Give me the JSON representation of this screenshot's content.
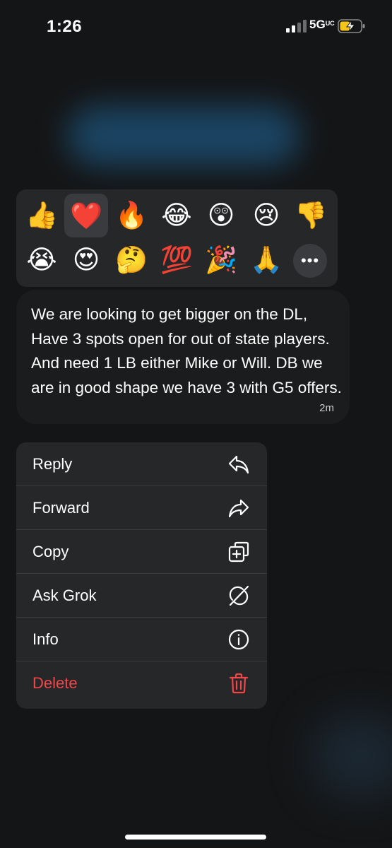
{
  "status_bar": {
    "time": "1:26",
    "network": "5G",
    "network_suffix": "UC"
  },
  "reactions": {
    "row1": [
      "👍",
      "❤️",
      "🔥",
      "😂",
      "😲",
      "😢",
      "👎"
    ],
    "row2": [
      "😭",
      "😍",
      "🤔",
      "💯",
      "🎉",
      "🙏"
    ],
    "more_label": "•••",
    "selected_index": 1
  },
  "message": {
    "text": "We are looking to get bigger on the DL, Have 3 spots open for out of state players. And need 1 LB either Mike or Will. DB we are in good shape we have 3 with G5 offers.",
    "time": "2m"
  },
  "menu": {
    "reply": "Reply",
    "forward": "Forward",
    "copy": "Copy",
    "ask_grok": "Ask Grok",
    "info": "Info",
    "delete": "Delete"
  },
  "colors": {
    "danger": "#f0474a",
    "battery": "#f5c518"
  }
}
